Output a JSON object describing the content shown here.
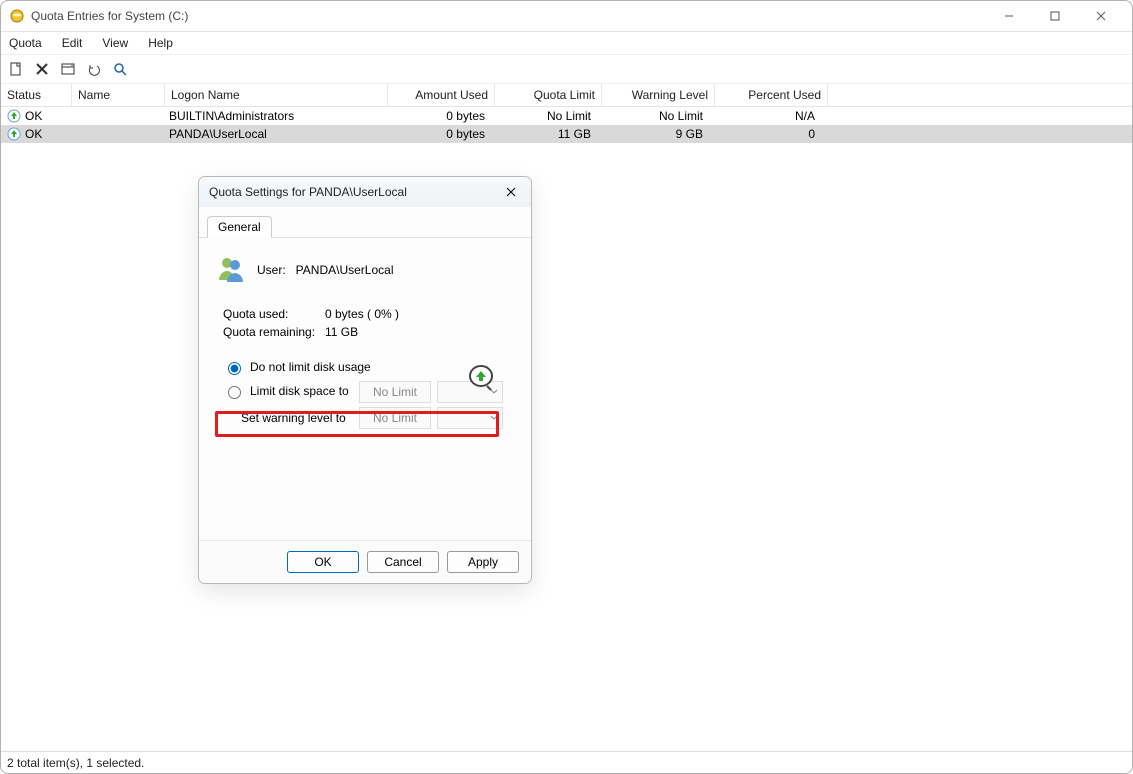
{
  "window": {
    "title": "Quota Entries for System (C:)",
    "controls": {
      "min": "Minimize",
      "max": "Maximize",
      "close": "Close"
    }
  },
  "menu": {
    "quota": "Quota",
    "edit": "Edit",
    "view": "View",
    "help": "Help"
  },
  "toolbar": {
    "new": "New",
    "delete": "Delete",
    "props": "Properties",
    "undo": "Undo",
    "find": "Find"
  },
  "columns": {
    "status": "Status",
    "name": "Name",
    "logon": "Logon Name",
    "amount": "Amount Used",
    "limit": "Quota Limit",
    "warn": "Warning Level",
    "pct": "Percent Used"
  },
  "rows": [
    {
      "status": "OK",
      "name": "",
      "logon": "BUILTIN\\Administrators",
      "amount": "0 bytes",
      "limit": "No Limit",
      "warn": "No Limit",
      "pct": "N/A",
      "selected": false
    },
    {
      "status": "OK",
      "name": "",
      "logon": "PANDA\\UserLocal",
      "amount": "0 bytes",
      "limit": "11 GB",
      "warn": "9 GB",
      "pct": "0",
      "selected": true
    }
  ],
  "statusbar": "2 total item(s), 1 selected.",
  "dialog": {
    "title": "Quota Settings for PANDA\\UserLocal",
    "tab": "General",
    "user_label": "User:",
    "user_value": "PANDA\\UserLocal",
    "used_label": "Quota used:",
    "used_value": "0 bytes ( 0% )",
    "rem_label": "Quota remaining:",
    "rem_value": "11 GB",
    "opt_nolimit": "Do not limit disk usage",
    "opt_limit": "Limit disk space to",
    "opt_warn": "Set warning level to",
    "combo_nolimit": "No Limit",
    "btn_ok": "OK",
    "btn_cancel": "Cancel",
    "btn_apply": "Apply"
  }
}
